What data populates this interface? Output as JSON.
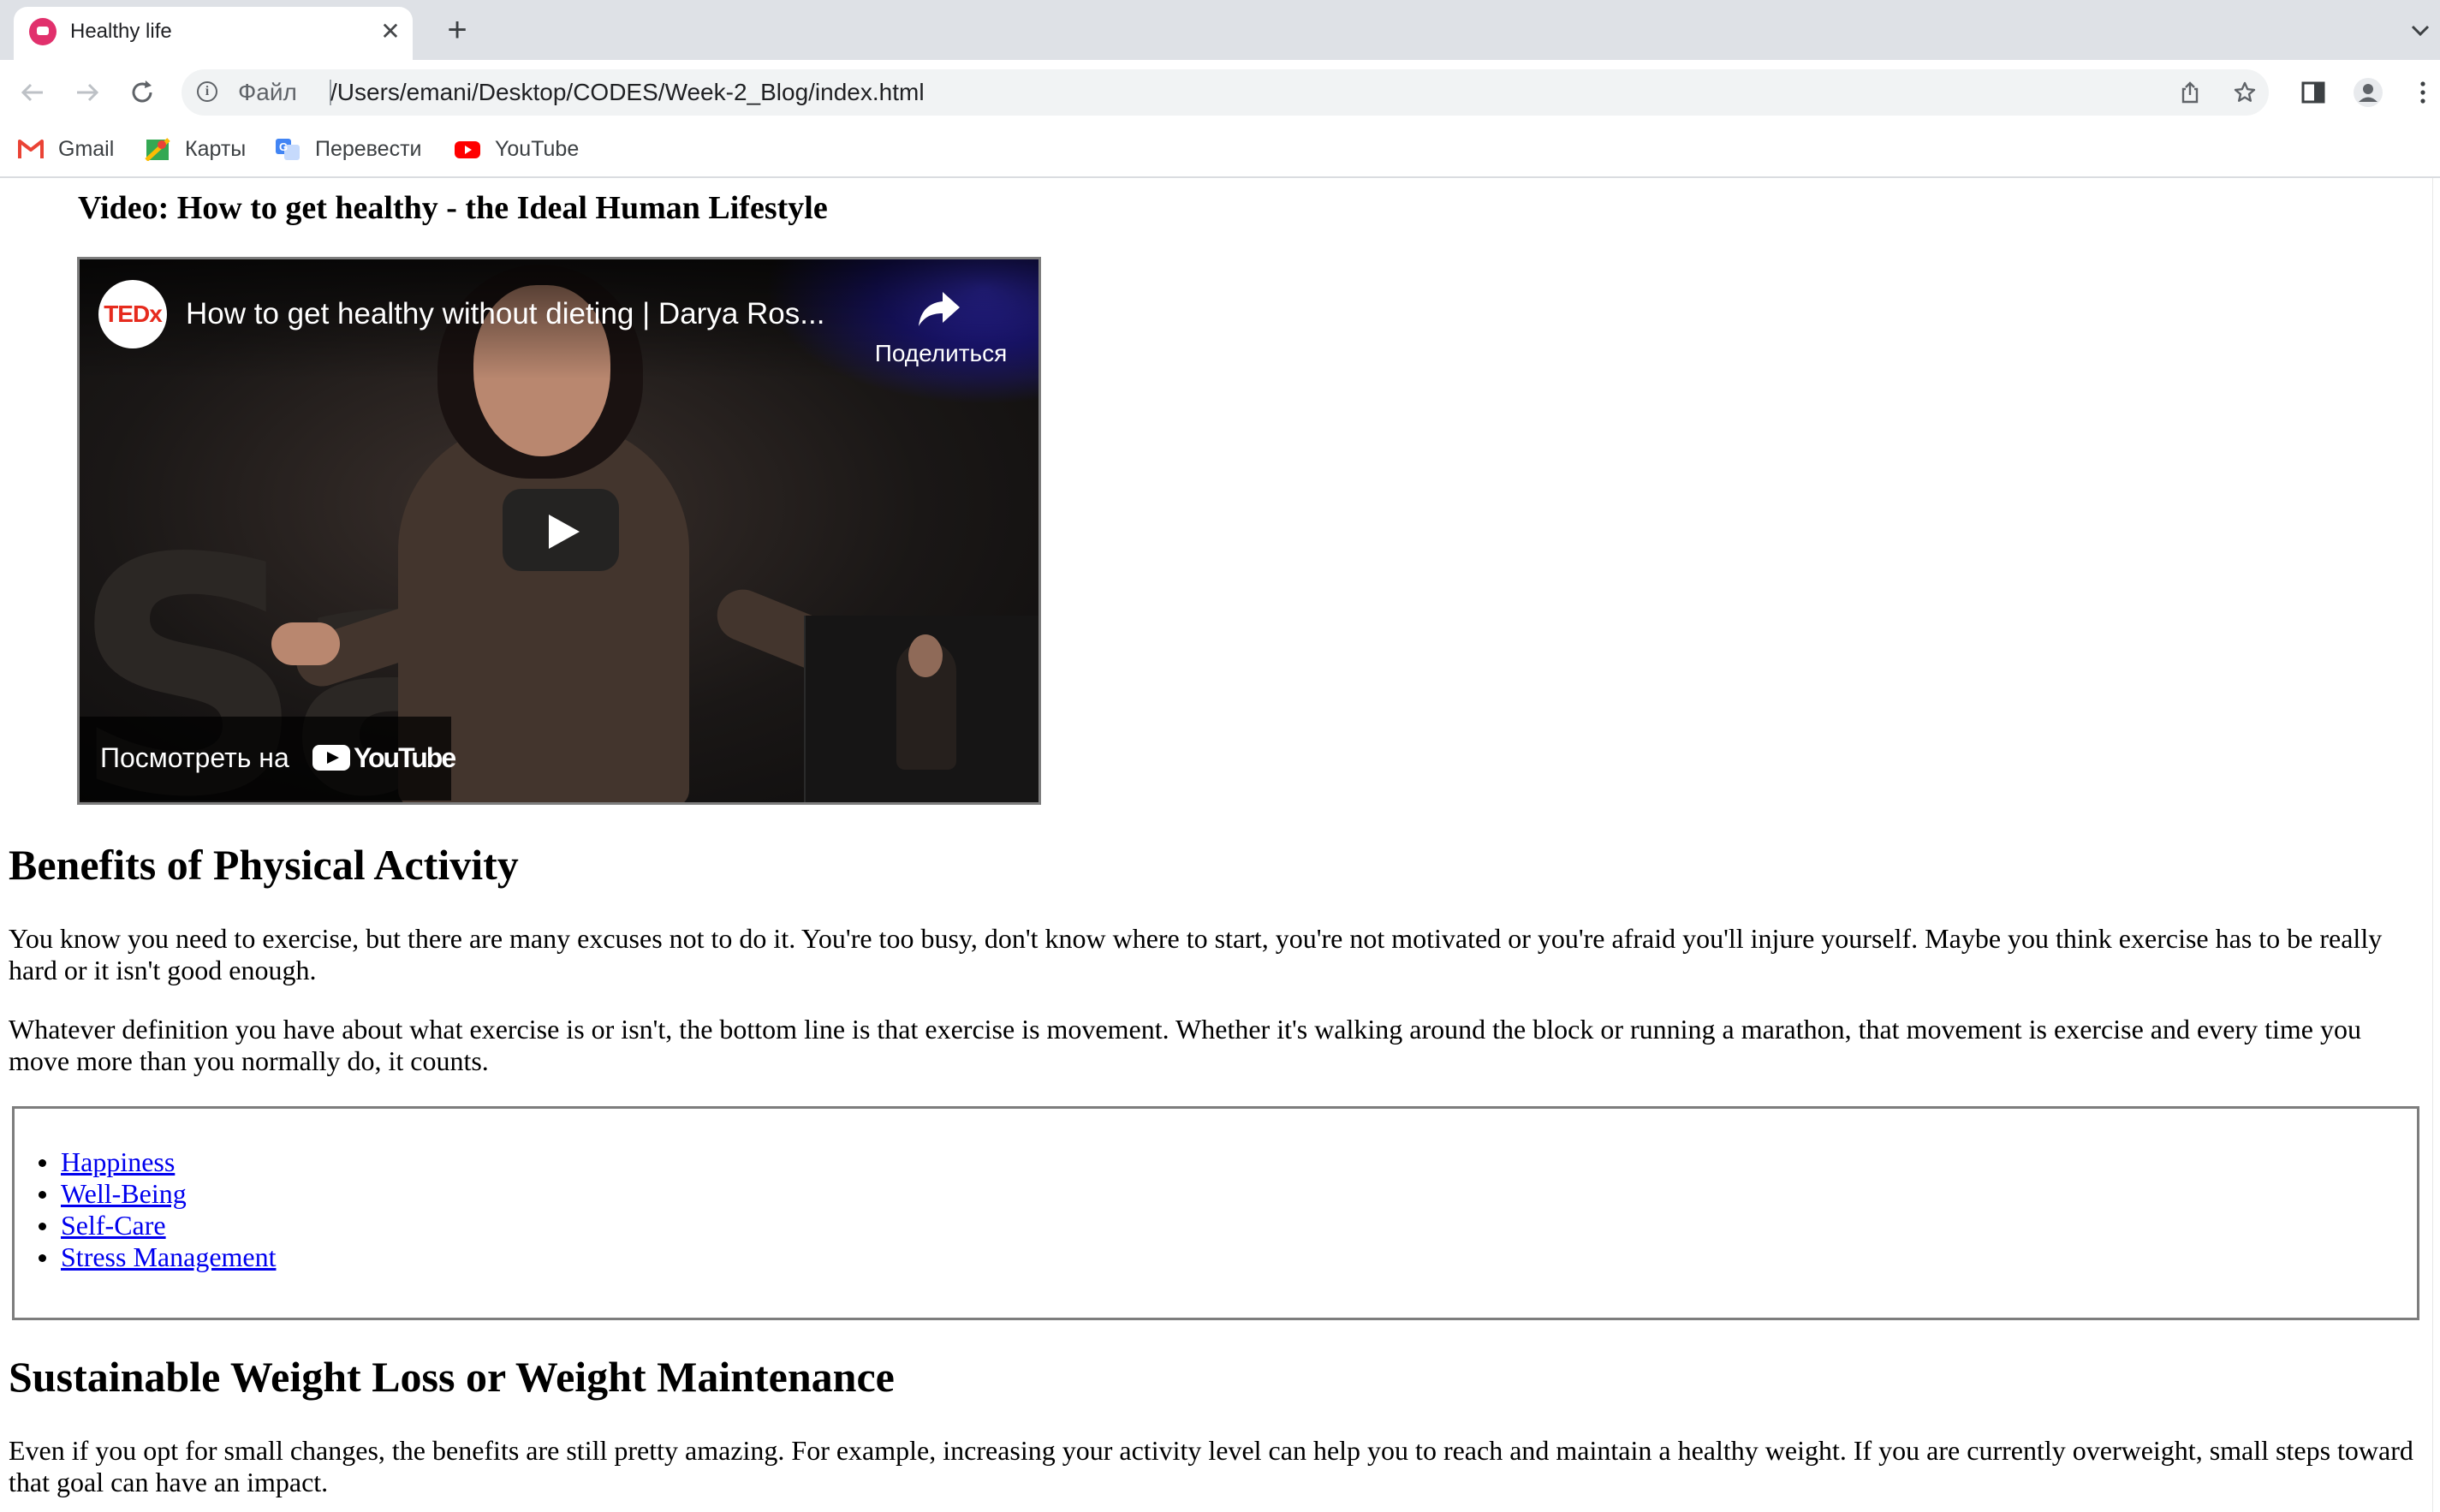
{
  "browser": {
    "tab_title": "Healthy life",
    "tab_close": "✕",
    "new_tab": "+",
    "scheme_label": "Файл",
    "url": "/Users/emani/Desktop/CODES/Week-2_Blog/index.html",
    "bookmarks": [
      {
        "label": "Gmail",
        "icon": "gmail-icon"
      },
      {
        "label": "Карты",
        "icon": "maps-icon"
      },
      {
        "label": "Перевести",
        "icon": "translate-icon"
      },
      {
        "label": "YouTube",
        "icon": "youtube-icon"
      }
    ]
  },
  "page": {
    "video_heading": "Video: How to get healthy - the Ideal Human Lifestyle",
    "video": {
      "channel_logo": "TEDx",
      "title": "How to get healthy without dieting | Darya Ros...",
      "share_label": "Поделиться",
      "watch_on_label": "Посмотреть на",
      "youtube_word": "YouTube",
      "backdrop_letters": "Sa"
    },
    "section1": {
      "heading": "Benefits of Physical Activity",
      "paragraphs": [
        "You know you need to exercise, but there are many excuses not to do it. You're too busy, don't know where to start, you're not motivated or you're afraid you'll injure yourself. Maybe you think exercise has to be really hard or it isn't good enough.",
        "Whatever definition you have about what exercise is or isn't, the bottom line is that exercise is movement. Whether it's walking around the block or running a marathon, that movement is exercise and every time you move more than you normally do, it counts."
      ],
      "links": [
        "Happiness",
        "Well-Being",
        "Self-Care",
        "Stress Management"
      ]
    },
    "section2": {
      "heading": "Sustainable Weight Loss or Weight Maintenance",
      "paragraph": "Even if you opt for small changes, the benefits are still pretty amazing. For example, increasing your activity level can help you to reach and maintain a healthy weight. If you are currently overweight, small steps toward that goal can have an impact."
    }
  },
  "colors": {
    "tabstrip": "#dee1e6",
    "omnibox": "#f1f3f4",
    "link": "#0000ee",
    "ted_red": "#e62b1e"
  }
}
